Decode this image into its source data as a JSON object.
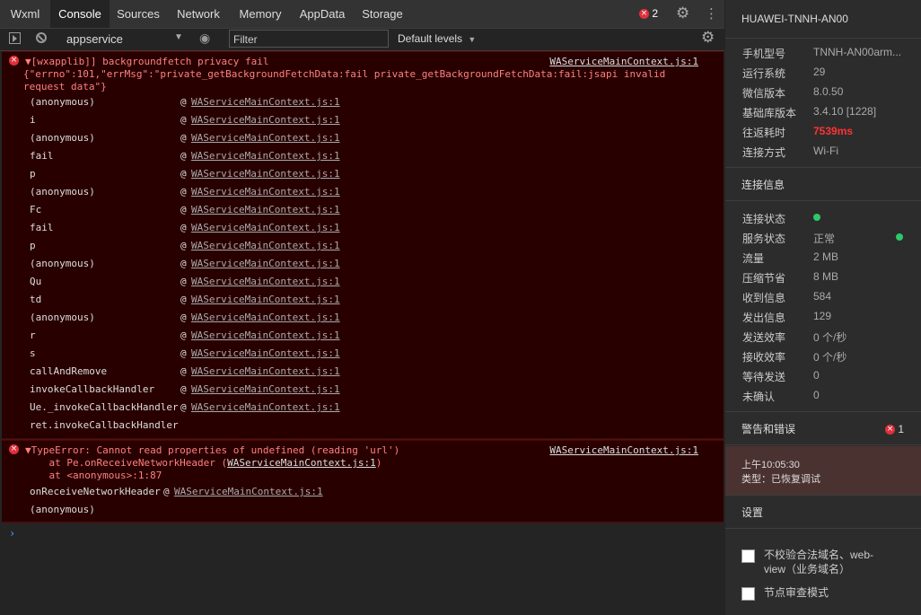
{
  "tabs": [
    {
      "label": "Wxml"
    },
    {
      "label": "Console"
    },
    {
      "label": "Sources"
    },
    {
      "label": "Network"
    },
    {
      "label": "Memory"
    },
    {
      "label": "AppData"
    },
    {
      "label": "Storage"
    }
  ],
  "error_count": "2",
  "toolbar": {
    "context": "appservice",
    "filter_placeholder": "Filter",
    "levels": "Default levels"
  },
  "msg1": {
    "title": "▼[wxapplib]] backgroundfetch privacy fail",
    "detail1": "{\"errno\":101,\"errMsg\":\"private_getBackgroundFetchData:fail private_getBackgroundFetchData:fail:jsapi invalid",
    "detail2": "request data\"}",
    "source": "WAServiceMainContext.js:1",
    "frames": [
      {
        "fn": "(anonymous)",
        "link": "WAServiceMainContext.js:1"
      },
      {
        "fn": "i",
        "link": "WAServiceMainContext.js:1"
      },
      {
        "fn": "(anonymous)",
        "link": "WAServiceMainContext.js:1"
      },
      {
        "fn": "fail",
        "link": "WAServiceMainContext.js:1"
      },
      {
        "fn": "p",
        "link": "WAServiceMainContext.js:1"
      },
      {
        "fn": "(anonymous)",
        "link": "WAServiceMainContext.js:1"
      },
      {
        "fn": "Fc",
        "link": "WAServiceMainContext.js:1"
      },
      {
        "fn": "fail",
        "link": "WAServiceMainContext.js:1"
      },
      {
        "fn": "p",
        "link": "WAServiceMainContext.js:1"
      },
      {
        "fn": "(anonymous)",
        "link": "WAServiceMainContext.js:1"
      },
      {
        "fn": "Qu",
        "link": "WAServiceMainContext.js:1"
      },
      {
        "fn": "td",
        "link": "WAServiceMainContext.js:1"
      },
      {
        "fn": "(anonymous)",
        "link": "WAServiceMainContext.js:1"
      },
      {
        "fn": "r",
        "link": "WAServiceMainContext.js:1"
      },
      {
        "fn": "s",
        "link": "WAServiceMainContext.js:1"
      },
      {
        "fn": "callAndRemove",
        "link": "WAServiceMainContext.js:1"
      },
      {
        "fn": "invokeCallbackHandler",
        "link": "WAServiceMainContext.js:1"
      },
      {
        "fn": "Ue._invokeCallbackHandler",
        "link": "WAServiceMainContext.js:1"
      },
      {
        "fn": "ret.invokeCallbackHandler",
        "link": ""
      }
    ]
  },
  "msg2": {
    "title": "▼TypeError: Cannot read properties of undefined (reading 'url')",
    "at1_pre": "    at Pe.onReceiveNetworkHeader (",
    "at1_link": "WAServiceMainContext.js:1",
    "at1_post": ")",
    "at2": "    at <anonymous>:1:87",
    "source": "WAServiceMainContext.js:1",
    "frame1_fn": "onReceiveNetworkHeader",
    "frame1_link": "WAServiceMainContext.js:1",
    "frame2_fn": "(anonymous)"
  },
  "prompt": "›",
  "panel": {
    "device": "HUAWEI-TNNH-AN00",
    "info": [
      {
        "k": "手机型号",
        "v": "TNNH-AN00arm..."
      },
      {
        "k": "运行系统",
        "v": "29"
      },
      {
        "k": "微信版本",
        "v": "8.0.50"
      },
      {
        "k": "基础库版本",
        "v": "3.4.10 [1228]"
      },
      {
        "k": "往返耗时",
        "v": "7539ms"
      },
      {
        "k": "连接方式",
        "v": "Wi-Fi"
      }
    ],
    "conn_title": "连接信息",
    "conn": [
      {
        "k": "连接状态",
        "v": ""
      },
      {
        "k": "服务状态",
        "v": "正常"
      },
      {
        "k": "流量",
        "v": "2 MB"
      },
      {
        "k": "压缩节省",
        "v": "8 MB"
      },
      {
        "k": "收到信息",
        "v": "584"
      },
      {
        "k": "发出信息",
        "v": "129"
      },
      {
        "k": "发送效率",
        "v": "0 个/秒"
      },
      {
        "k": "接收效率",
        "v": "0 个/秒"
      },
      {
        "k": "等待发送",
        "v": "0"
      },
      {
        "k": "未确认",
        "v": "0"
      }
    ],
    "warn_title": "警告和错误",
    "warn_count": "1",
    "log_time": "上午10:05:30",
    "log_type": "类型：已恢复调试",
    "settings_title": "设置",
    "opt1_line1": "不校验合法域名、web-",
    "opt1_line2": "view（业务域名）",
    "opt2": "节点审查模式",
    "colors": {
      "rtt": "#ff3333",
      "error_bg": "#290000",
      "status_green": "#2ec86a"
    }
  }
}
